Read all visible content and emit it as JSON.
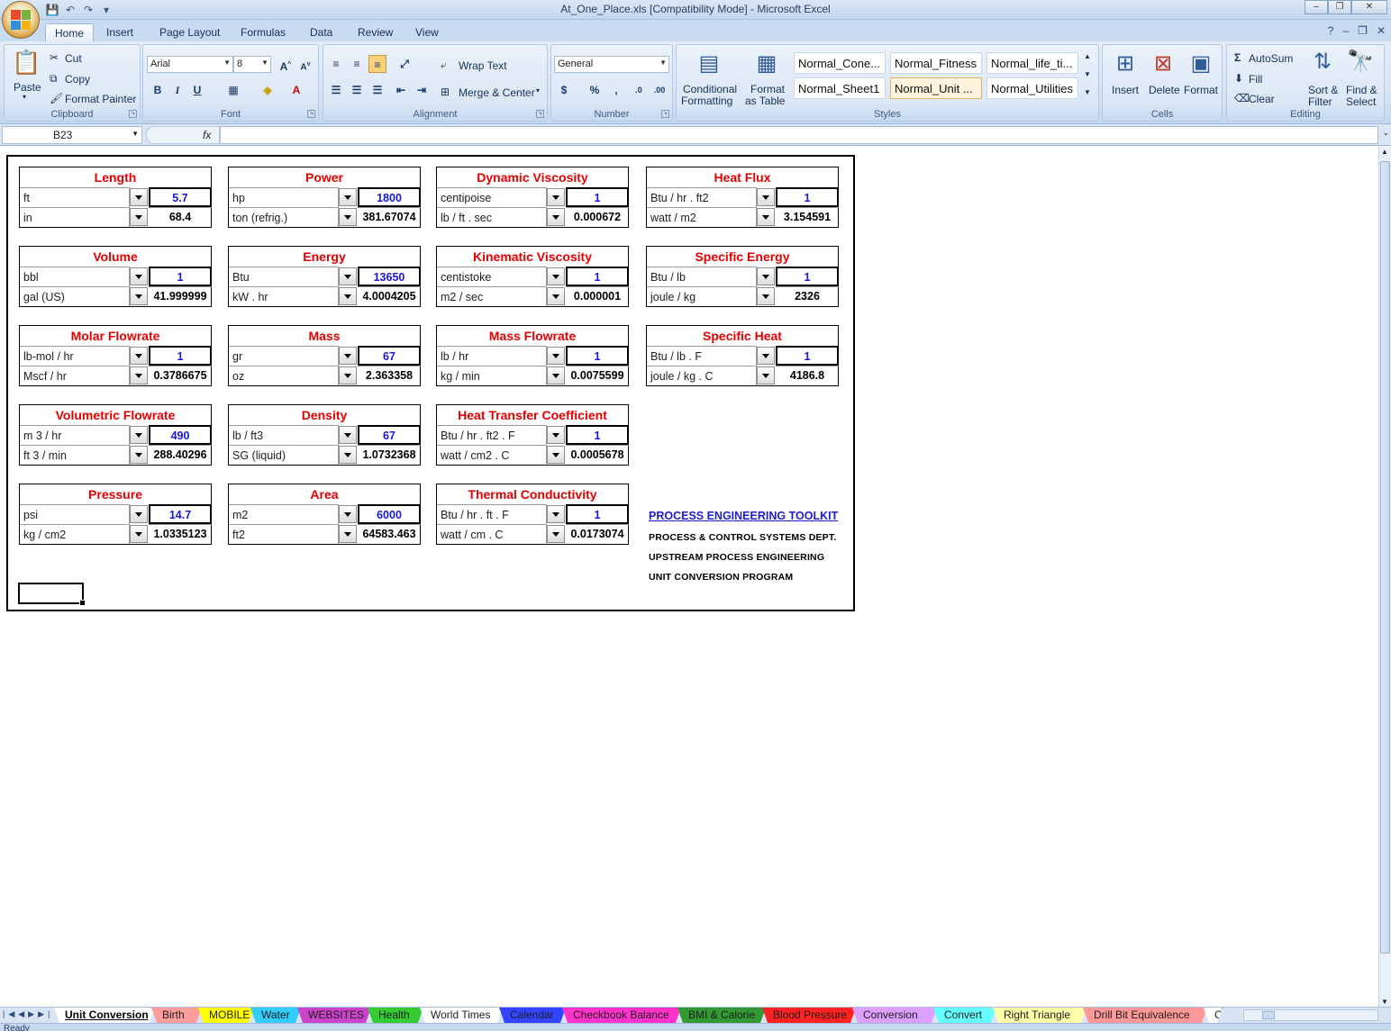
{
  "window": {
    "title": "At_One_Place.xls  [Compatibility Mode] - Microsoft Excel",
    "minimize": "–",
    "restore": "❐",
    "close": "✕"
  },
  "ribbon_tabs": [
    "Home",
    "Insert",
    "Page Layout",
    "Formulas",
    "Data",
    "Review",
    "View"
  ],
  "clipboard": {
    "paste": "Paste",
    "cut": "Cut",
    "copy": "Copy",
    "format_painter": "Format Painter",
    "label": "Clipboard"
  },
  "font": {
    "name": "Arial",
    "size": "8",
    "bold": "B",
    "italic": "I",
    "underline": "U",
    "label": "Font"
  },
  "alignment": {
    "wrap_text": "Wrap Text",
    "merge_center": "Merge & Center",
    "label": "Alignment"
  },
  "number": {
    "format": "General",
    "currency": "$",
    "percent": "%",
    "comma": ",",
    "label": "Number"
  },
  "styles": {
    "conditional_formatting": [
      "Conditional",
      "Formatting"
    ],
    "format_as_table": [
      "Format",
      "as Table"
    ],
    "cells": [
      "Normal_Cone...",
      "Normal_Fitness",
      "Normal_life_ti...",
      "Normal_Sheet1",
      "Normal_Unit ...",
      "Normal_Utilities"
    ],
    "label": "Styles"
  },
  "cells_group": {
    "insert": "Insert",
    "delete": "Delete",
    "format": "Format",
    "label": "Cells"
  },
  "editing": {
    "autosum": "AutoSum",
    "fill": "Fill",
    "clear": "Clear",
    "sort_filter": [
      "Sort &",
      "Filter"
    ],
    "find_select": [
      "Find &",
      "Select"
    ],
    "label": "Editing"
  },
  "formula_bar": {
    "name_box": "B23",
    "fx": "fx",
    "value": ""
  },
  "converters": [
    {
      "title": "Length",
      "unit1": "ft",
      "value1": "5.7",
      "unit2": "in",
      "value2": "68.4"
    },
    {
      "title": "Power",
      "unit1": "hp",
      "value1": "1800",
      "unit2": "ton  (refrig.)",
      "value2": "381.67074"
    },
    {
      "title": "Dynamic Viscosity",
      "unit1": "centipoise",
      "value1": "1",
      "unit2": "lb / ft . sec",
      "value2": "0.000672"
    },
    {
      "title": "Heat Flux",
      "unit1": "Btu / hr . ft2",
      "value1": "1",
      "unit2": "watt / m2",
      "value2": "3.154591"
    },
    {
      "title": "Volume",
      "unit1": "bbl",
      "value1": "1",
      "unit2": "gal  (US)",
      "value2": "41.999999"
    },
    {
      "title": "Energy",
      "unit1": "Btu",
      "value1": "13650",
      "unit2": "kW .  hr",
      "value2": "4.0004205"
    },
    {
      "title": "Kinematic Viscosity",
      "unit1": "centistoke",
      "value1": "1",
      "unit2": "m2 / sec",
      "value2": "0.000001"
    },
    {
      "title": "Specific Energy",
      "unit1": "Btu / lb",
      "value1": "1",
      "unit2": "joule / kg",
      "value2": "2326"
    },
    {
      "title": "Molar Flowrate",
      "unit1": "lb-mol / hr",
      "value1": "1",
      "unit2": "Mscf / hr",
      "value2": "0.3786675"
    },
    {
      "title": "Mass",
      "unit1": "gr",
      "value1": "67",
      "unit2": "oz",
      "value2": "2.363358"
    },
    {
      "title": "Mass Flowrate",
      "unit1": "lb / hr",
      "value1": "1",
      "unit2": "kg / min",
      "value2": "0.0075599"
    },
    {
      "title": "Specific Heat",
      "unit1": "Btu / lb . F",
      "value1": "1",
      "unit2": "joule / kg . C",
      "value2": "4186.8"
    },
    {
      "title": "Volumetric Flowrate",
      "unit1": "m 3 / hr",
      "value1": "490",
      "unit2": "ft 3 / min",
      "value2": "288.40296"
    },
    {
      "title": "Density",
      "unit1": "lb / ft3",
      "value1": "67",
      "unit2": "SG  (liquid)",
      "value2": "1.0732368"
    },
    {
      "title": "Heat Transfer Coefficient",
      "unit1": "Btu / hr . ft2 . F",
      "value1": "1",
      "unit2": "watt / cm2 . C",
      "value2": "0.0005678"
    },
    {
      "title": "Pressure",
      "unit1": "psi",
      "value1": "14.7",
      "unit2": "kg / cm2",
      "value2": "1.0335123"
    },
    {
      "title": "Area",
      "unit1": "m2",
      "value1": "6000",
      "unit2": "ft2",
      "value2": "64583.463"
    },
    {
      "title": "Thermal Conductivity",
      "unit1": "Btu / hr . ft . F",
      "value1": "1",
      "unit2": "watt / cm . C",
      "value2": "0.0173074"
    }
  ],
  "toolkit": {
    "link": "PROCESS ENGINEERING TOOLKIT",
    "line1": "PROCESS & CONTROL SYSTEMS DEPT.",
    "line2": "UPSTREAM PROCESS ENGINEERING",
    "line3": "UNIT CONVERSION PROGRAM"
  },
  "sheet_tabs": [
    {
      "label": "Unit Conversion",
      "color": "#ffffff"
    },
    {
      "label": "Birth",
      "color": "#ff9d9d"
    },
    {
      "label": "MOBILE",
      "color": "#ffff00"
    },
    {
      "label": "Water",
      "color": "#33ccff"
    },
    {
      "label": "WEBSITES",
      "color": "#cc44cc"
    },
    {
      "label": "Health",
      "color": "#33cc33"
    },
    {
      "label": "World Times",
      "color": "#ffffff"
    },
    {
      "label": "Calendar",
      "color": "#3344ff"
    },
    {
      "label": "Checkbook Balance",
      "color": "#ff33cc"
    },
    {
      "label": "BMI & Calorie",
      "color": "#339933"
    },
    {
      "label": "Blood Pressure",
      "color": "#ff2222"
    },
    {
      "label": "Conversion",
      "color": "#dda0ff"
    },
    {
      "label": "Convert",
      "color": "#66ffff"
    },
    {
      "label": "Right Triangle",
      "color": "#ffffaa"
    },
    {
      "label": "Drill Bit Equivalence",
      "color": "#ff9999"
    },
    {
      "label": "C",
      "color": "#ffffff"
    }
  ],
  "status": {
    "text": "Ready"
  }
}
